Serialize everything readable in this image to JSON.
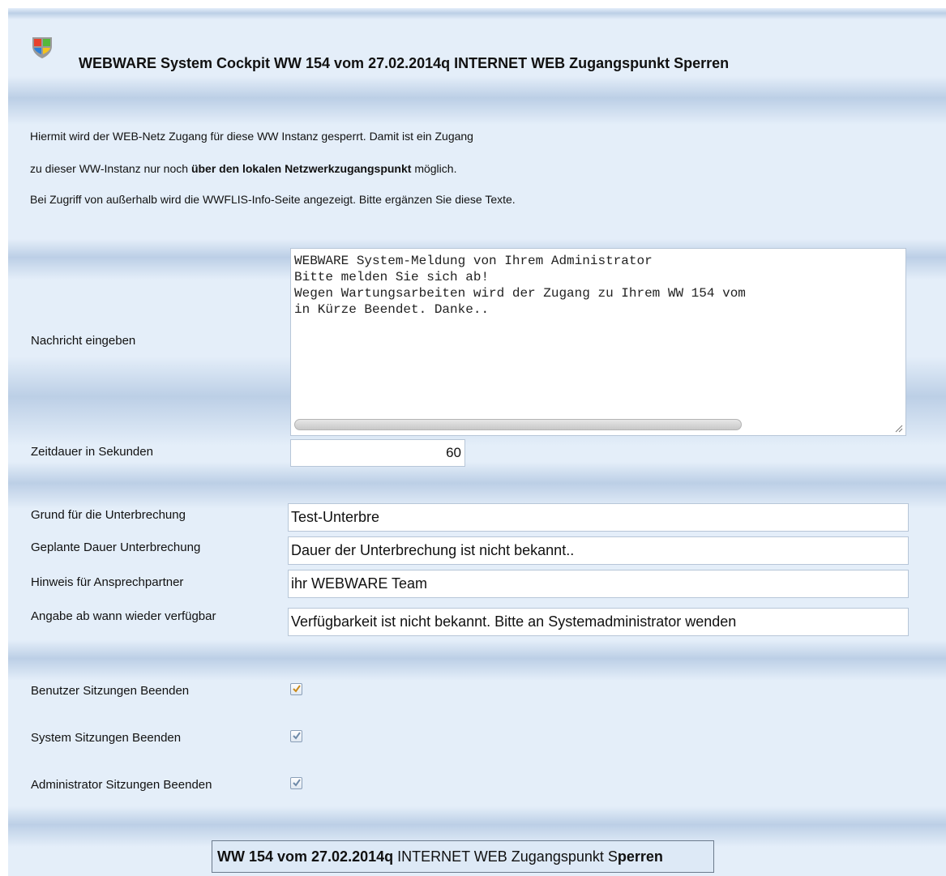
{
  "header": {
    "title": "WEBWARE System Cockpit WW 154 vom 27.02.2014q INTERNET WEB Zugangspunkt Sperren"
  },
  "intro": {
    "line1": "Hiermit wird der WEB-Netz Zugang für diese WW Instanz gesperrt. Damit ist ein Zugang",
    "line2_pre": "zu dieser WW-Instanz nur noch ",
    "line2_bold": "über den lokalen Netzwerkzugangspunkt",
    "line2_post": " möglich.",
    "line3": "Bei Zugriff von außerhalb wird die WWFLIS-Info-Seite angezeigt. Bitte ergänzen Sie diese Texte."
  },
  "form": {
    "message_label": "Nachricht eingeben",
    "message_value": "WEBWARE System-Meldung von Ihrem Administrator\nBitte melden Sie sich ab!\nWegen Wartungsarbeiten wird der Zugang zu Ihrem WW 154 vom\nin Kürze Beendet. Danke..",
    "duration_label": "Zeitdauer in Sekunden",
    "duration_value": "60",
    "reason_label": "Grund für die Unterbrechung",
    "reason_value": "Test-Unterbre",
    "planned_label": "Geplante Dauer Unterbrechung",
    "planned_value": "Dauer der Unterbrechung ist nicht bekannt..",
    "contact_label": "Hinweis für Ansprechpartner",
    "contact_value": "ihr WEBWARE Team",
    "available_label": "Angabe ab wann wieder verfügbar",
    "available_value": "Verfügbarkeit ist nicht bekannt. Bitte an Systemadministrator wenden"
  },
  "checkboxes": {
    "user_label": "Benutzer Sitzungen Beenden",
    "user_checked": true,
    "system_label": "System Sitzungen Beenden",
    "system_checked": true,
    "admin_label": "Administrator Sitzungen Beenden",
    "admin_checked": true
  },
  "submit": {
    "label_bold": "WW 154 vom 27.02.2014q",
    "label_mid": " INTERNET WEB Zugangspunkt S",
    "label_tail": "perren"
  },
  "colors": {
    "panel_background": "#e4eef9",
    "band_dark": "#bccfe6",
    "checkbox_check": "#c98a1a",
    "checkbox_check_disabled": "#6f8aa8"
  },
  "icons": {
    "title_icon": "windows-shield-icon"
  }
}
